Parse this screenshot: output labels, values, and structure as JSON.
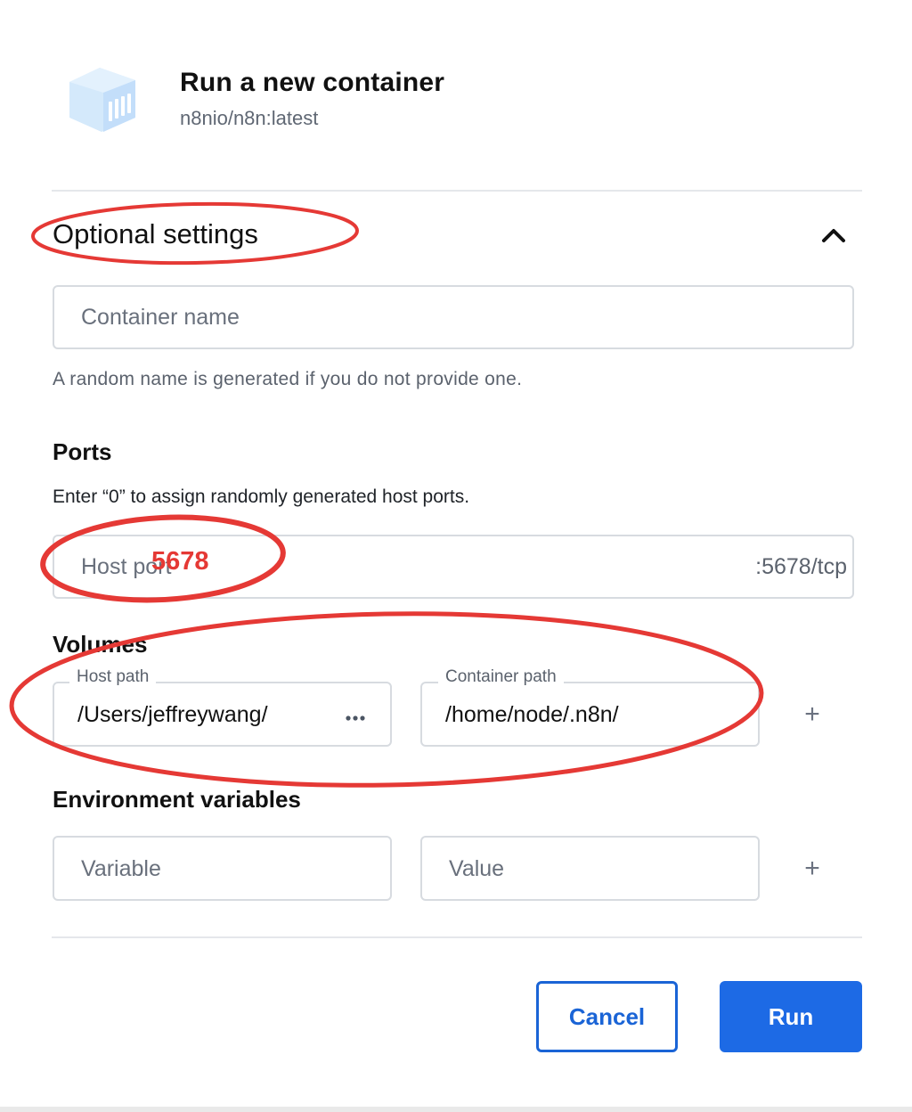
{
  "header": {
    "icon": "container-cube-icon",
    "title": "Run a new container",
    "image_name": "n8nio/n8n:latest"
  },
  "optional_settings": {
    "title": "Optional settings",
    "toggle_icon": "chevron-up-icon",
    "container_name": {
      "placeholder": "Container name",
      "value": ""
    },
    "container_name_helper": "A random name is generated if you do not provide one."
  },
  "ports": {
    "title": "Ports",
    "description": "Enter “0” to assign randomly generated host ports.",
    "host_port_placeholder": "Host port",
    "container_port": ":5678/tcp"
  },
  "volumes": {
    "title": "Volumes",
    "host_path_label": "Host path",
    "host_path_value": "/Users/jeffreywang/",
    "browse_icon": "ellipsis-icon",
    "container_path_label": "Container path",
    "container_path_value": "/home/node/.n8n/",
    "add_icon": "plus-icon"
  },
  "environment": {
    "title": "Environment variables",
    "variable_placeholder": "Variable",
    "value_placeholder": "Value",
    "add_icon": "plus-icon"
  },
  "actions": {
    "cancel_label": "Cancel",
    "run_label": "Run"
  },
  "annotations": {
    "port_note": "5678",
    "color": "#e53935"
  },
  "colors": {
    "primary": "#1d6ae5",
    "icon_cube": "#cfe6fb"
  }
}
